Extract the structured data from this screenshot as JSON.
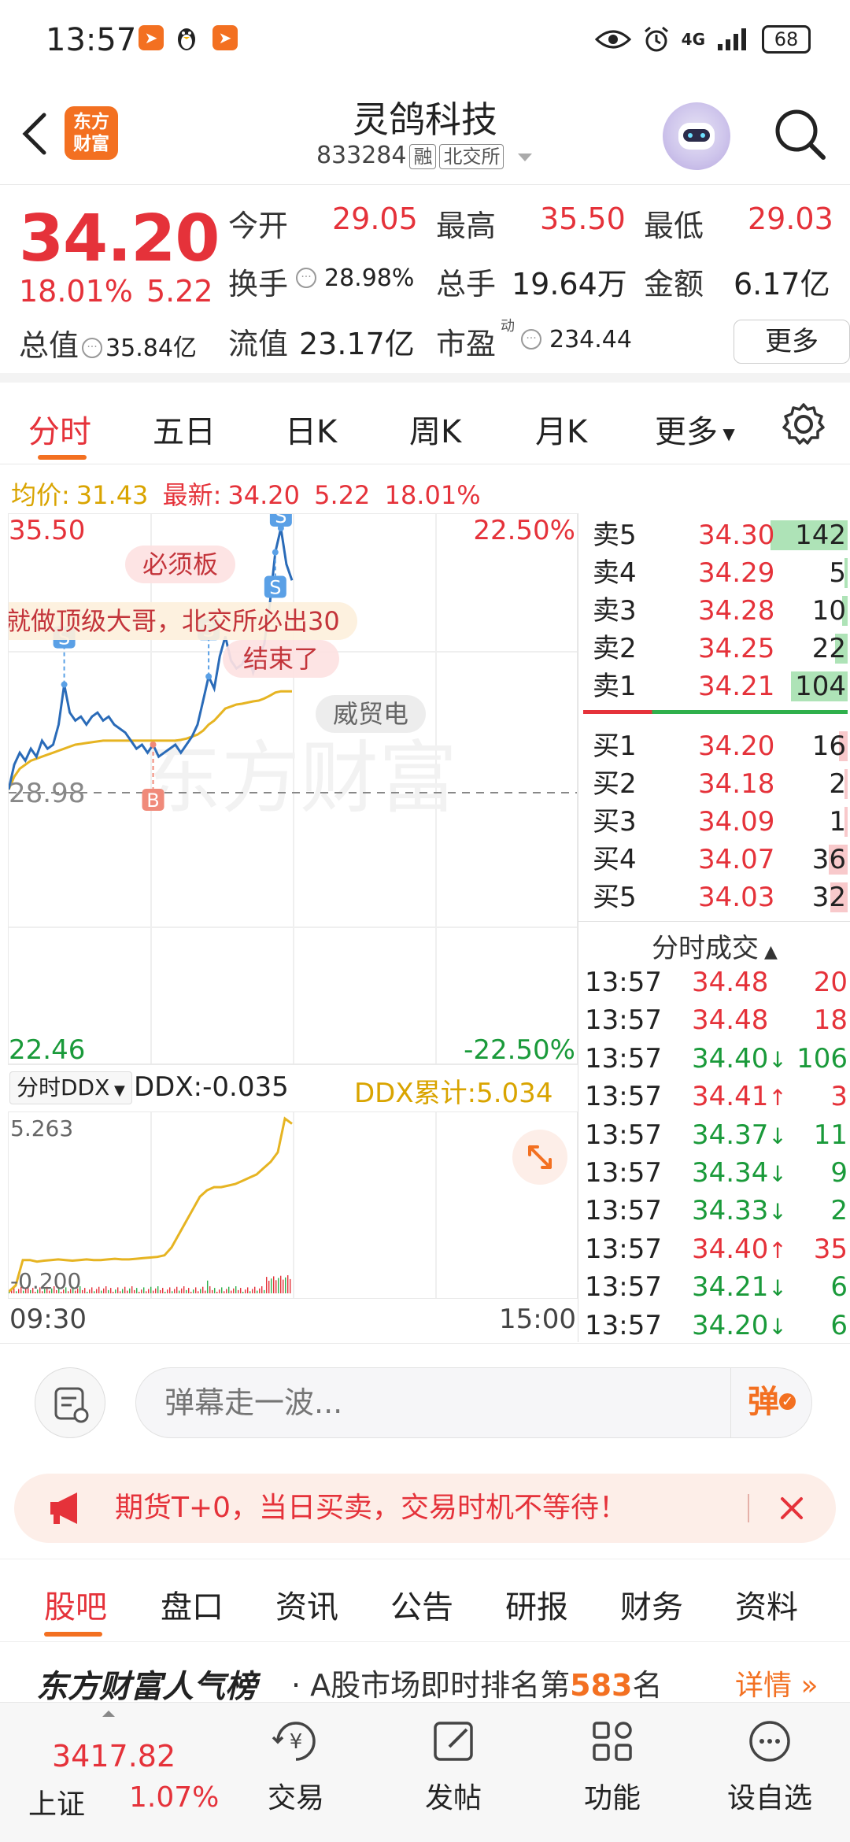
{
  "status_bar": {
    "time": "13:57",
    "network": "4G",
    "battery": "68"
  },
  "header": {
    "logo_text": "东方财富",
    "title": "灵鸽科技",
    "code": "833284",
    "margin_tag": "融",
    "exchange_tag": "北交所"
  },
  "quote": {
    "price": "34.20",
    "change_pct": "18.01%",
    "change_amt": "5.22",
    "open_label": "今开",
    "open": "29.05",
    "high_label": "最高",
    "high": "35.50",
    "low_label": "最低",
    "low": "29.03",
    "turnover_label": "换手",
    "turnover": "28.98%",
    "volume_label": "总手",
    "volume": "19.64万",
    "amount_label": "金额",
    "amount": "6.17亿",
    "total_value_label": "总值",
    "total_value": "35.84亿",
    "float_value_label": "流值",
    "float_value": "23.17亿",
    "pe_label": "市盈",
    "pe_sup": "动",
    "pe": "234.44",
    "more_button": "更多"
  },
  "period_tabs": [
    "分时",
    "五日",
    "日K",
    "周K",
    "月K",
    "更多"
  ],
  "avg_bar": {
    "avg_label": "均价:",
    "avg": "31.43",
    "latest_label": "最新:",
    "latest": "34.20",
    "chg": "5.22",
    "pct": "18.01%"
  },
  "chart": {
    "y_high": "35.50",
    "y_low": "22.46",
    "pct_high": "22.50%",
    "pct_low": "-22.50%",
    "prev_close": "28.98",
    "danmu": [
      "必须板",
      "就做顶级大哥，北交所必出30",
      "结束了",
      "威贸电"
    ],
    "watermark": "东方财富",
    "markers": [
      "S",
      "S",
      "S",
      "S",
      "B"
    ],
    "price_series": [
      28.98,
      29.6,
      29.9,
      29.7,
      30.0,
      29.8,
      30.2,
      30.0,
      30.1,
      30.6,
      31.6,
      30.9,
      30.7,
      30.8,
      30.6,
      30.8,
      30.9,
      30.7,
      30.8,
      30.6,
      30.5,
      30.4,
      30.2,
      30.0,
      30.1,
      29.9,
      30.1,
      29.8,
      29.9,
      30.0,
      30.1,
      29.9,
      30.1,
      30.3,
      30.6,
      31.2,
      31.8,
      31.5,
      32.3,
      32.8,
      32.2,
      32.0,
      32.1,
      32.4,
      31.9,
      32.3,
      32.6,
      33.6,
      34.9,
      35.5,
      34.6,
      34.2
    ],
    "avg_series": [
      28.98,
      29.3,
      29.5,
      29.6,
      29.7,
      29.75,
      29.8,
      29.85,
      29.9,
      29.95,
      30.0,
      30.05,
      30.1,
      30.12,
      30.14,
      30.16,
      30.18,
      30.2,
      30.2,
      30.2,
      30.2,
      30.2,
      30.2,
      30.2,
      30.2,
      30.2,
      30.2,
      30.2,
      30.2,
      30.2,
      30.2,
      30.22,
      30.25,
      30.3,
      30.35,
      30.45,
      30.6,
      30.7,
      30.85,
      31.0,
      31.05,
      31.1,
      31.12,
      31.15,
      31.18,
      31.2,
      31.25,
      31.32,
      31.4,
      31.43,
      31.43,
      31.43
    ]
  },
  "ddx": {
    "selector": "分时DDX",
    "ddx_label": "DDX:",
    "ddx": "-0.035",
    "cum_label": "DDX累计:",
    "cum": "5.034",
    "y_high": "5.263",
    "y_low": "-0.200",
    "series": [
      -0.2,
      0.0,
      0.8,
      0.8,
      0.75,
      0.78,
      0.8,
      0.82,
      0.8,
      0.78,
      0.8,
      0.82,
      0.8,
      0.8,
      0.82,
      0.84,
      0.82,
      0.82,
      0.84,
      0.86,
      0.88,
      0.9,
      0.95,
      1.2,
      1.6,
      2.0,
      2.4,
      2.8,
      3.0,
      3.1,
      3.1,
      3.15,
      3.2,
      3.3,
      3.4,
      3.5,
      3.7,
      3.9,
      4.2,
      5.263,
      5.1
    ],
    "time_start": "09:30",
    "time_end": "15:00"
  },
  "orderbook": {
    "asks": [
      {
        "label": "卖5",
        "price": "34.30",
        "vol": "142",
        "bar": 1.0
      },
      {
        "label": "卖4",
        "price": "34.29",
        "vol": "5",
        "bar": 0.04
      },
      {
        "label": "卖3",
        "price": "34.28",
        "vol": "10",
        "bar": 0.07
      },
      {
        "label": "卖2",
        "price": "34.25",
        "vol": "22",
        "bar": 0.16
      },
      {
        "label": "卖1",
        "price": "34.21",
        "vol": "104",
        "bar": 0.73
      }
    ],
    "bids": [
      {
        "label": "买1",
        "price": "34.20",
        "vol": "16",
        "bar": 0.11
      },
      {
        "label": "买2",
        "price": "34.18",
        "vol": "2",
        "bar": 0.02
      },
      {
        "label": "买3",
        "price": "34.09",
        "vol": "1",
        "bar": 0.01
      },
      {
        "label": "买4",
        "price": "34.07",
        "vol": "36",
        "bar": 0.25
      },
      {
        "label": "买5",
        "price": "34.03",
        "vol": "32",
        "bar": 0.22
      }
    ],
    "ticks_title": "分时成交",
    "ticks": [
      {
        "time": "13:57",
        "price": "34.48",
        "vol": "20",
        "dir": "",
        "color": "red"
      },
      {
        "time": "13:57",
        "price": "34.48",
        "vol": "18",
        "dir": "",
        "color": "red"
      },
      {
        "time": "13:57",
        "price": "34.40",
        "vol": "106",
        "dir": "↓",
        "color": "green"
      },
      {
        "time": "13:57",
        "price": "34.41",
        "vol": "3",
        "dir": "↑",
        "color": "red"
      },
      {
        "time": "13:57",
        "price": "34.37",
        "vol": "11",
        "dir": "↓",
        "color": "green"
      },
      {
        "time": "13:57",
        "price": "34.34",
        "vol": "9",
        "dir": "↓",
        "color": "green"
      },
      {
        "time": "13:57",
        "price": "34.33",
        "vol": "2",
        "dir": "↓",
        "color": "green"
      },
      {
        "time": "13:57",
        "price": "34.40",
        "vol": "35",
        "dir": "↑",
        "color": "red"
      },
      {
        "time": "13:57",
        "price": "34.21",
        "vol": "6",
        "dir": "↓",
        "color": "green"
      },
      {
        "time": "13:57",
        "price": "34.20",
        "vol": "6",
        "dir": "↓",
        "color": "green"
      }
    ]
  },
  "comment": {
    "placeholder": "弹幕走一波...",
    "danmu_button": "弹"
  },
  "ad": {
    "text": "期货T+0，当日买卖，交易时机不等待！"
  },
  "info_tabs": [
    "股吧",
    "盘口",
    "资讯",
    "公告",
    "研报",
    "财务",
    "资料"
  ],
  "rank": {
    "brand": "东方财富人气榜",
    "prefix": "· A股市场即时排名第",
    "rank": "583",
    "suffix": "名",
    "details": "详情"
  },
  "bottom_nav": {
    "index_value": "3417.82",
    "index_name": "上证",
    "index_pct": "1.07%",
    "items": [
      "交易",
      "发帖",
      "功能",
      "设自选"
    ]
  },
  "colors": {
    "up": "#e5323a",
    "down": "#1a9a3a",
    "brand": "#f37021",
    "price_line": "#2a6bb8",
    "avg_line": "#e6b422"
  }
}
